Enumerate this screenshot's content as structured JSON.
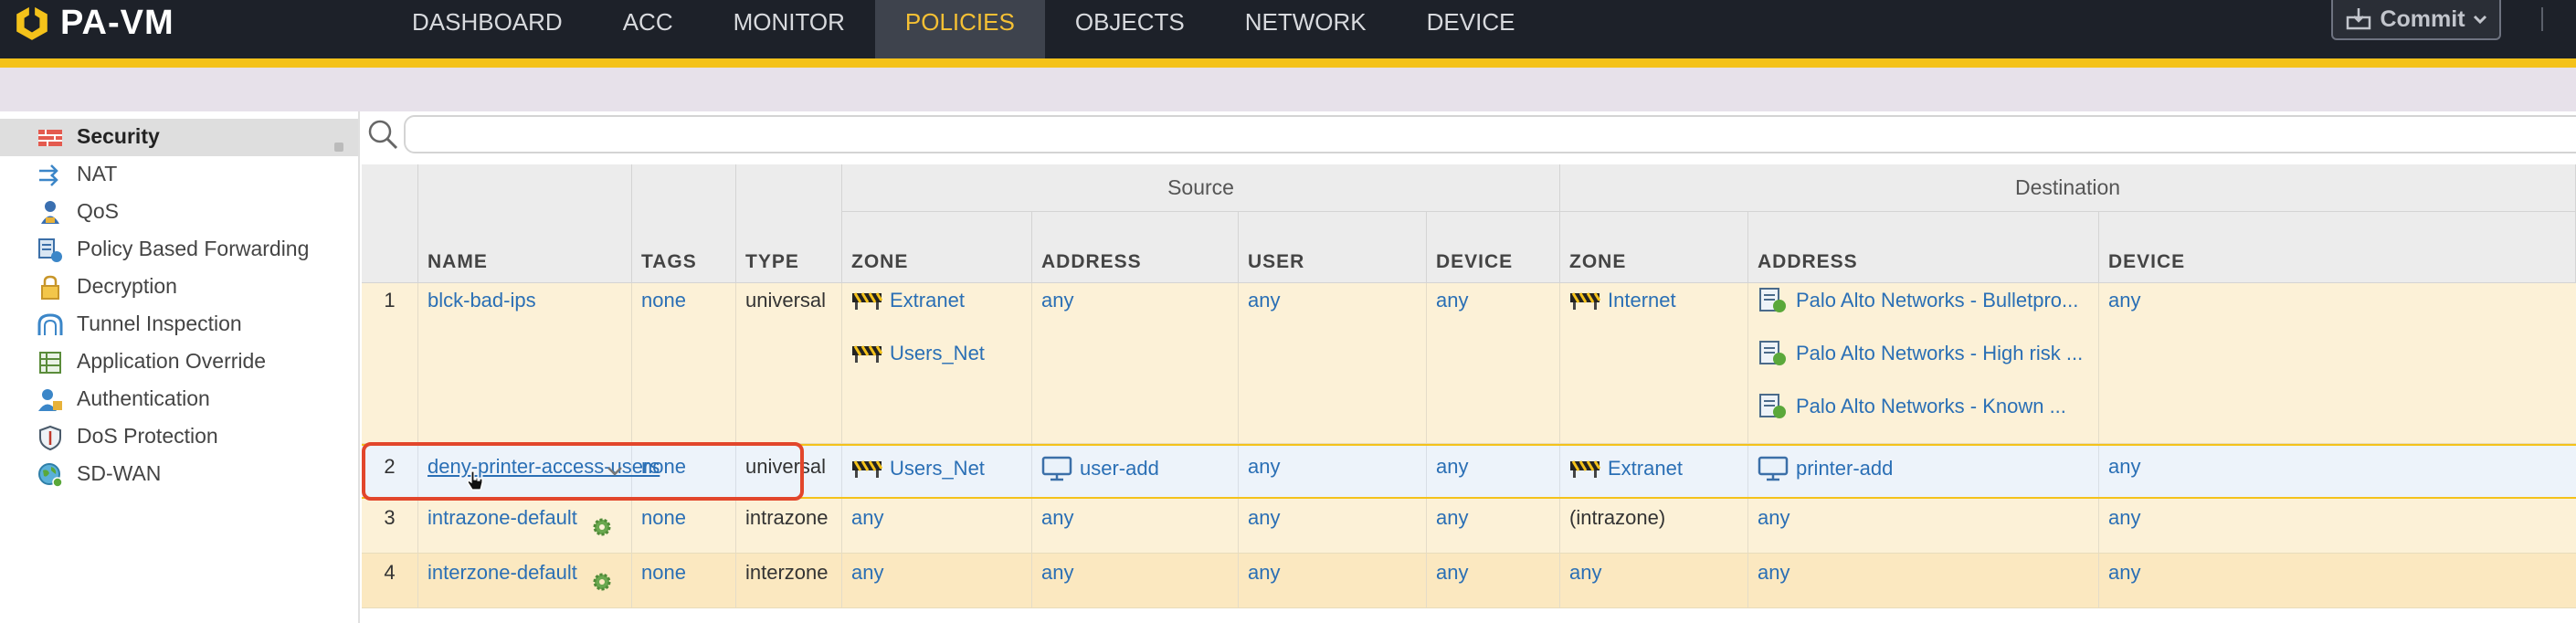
{
  "brand": {
    "name": "PA-VM"
  },
  "nav": {
    "tabs": [
      {
        "label": "DASHBOARD",
        "active": false
      },
      {
        "label": "ACC",
        "active": false
      },
      {
        "label": "MONITOR",
        "active": false
      },
      {
        "label": "POLICIES",
        "active": true
      },
      {
        "label": "OBJECTS",
        "active": false
      },
      {
        "label": "NETWORK",
        "active": false
      },
      {
        "label": "DEVICE",
        "active": false
      }
    ],
    "commit_label": "Commit"
  },
  "colors": {
    "accent": "#f4c21a",
    "topbar": "#1d2129",
    "selection_outline": "#e2462b",
    "link": "#2a6fb5"
  },
  "sidebar": {
    "items": [
      {
        "label": "Security",
        "icon": "firewall-icon",
        "active": true
      },
      {
        "label": "NAT",
        "icon": "nat-arrows-icon",
        "active": false
      },
      {
        "label": "QoS",
        "icon": "qos-person-icon",
        "active": false
      },
      {
        "label": "Policy Based Forwarding",
        "icon": "pbf-icon",
        "active": false
      },
      {
        "label": "Decryption",
        "icon": "lock-icon",
        "active": false
      },
      {
        "label": "Tunnel Inspection",
        "icon": "tunnel-icon",
        "active": false
      },
      {
        "label": "Application Override",
        "icon": "app-grid-icon",
        "active": false
      },
      {
        "label": "Authentication",
        "icon": "auth-icon",
        "active": false
      },
      {
        "label": "DoS Protection",
        "icon": "shield-icon",
        "active": false
      },
      {
        "label": "SD-WAN",
        "icon": "globe-icon",
        "active": false
      }
    ]
  },
  "search": {
    "value": "",
    "placeholder": ""
  },
  "table": {
    "groups": {
      "source": "Source",
      "destination": "Destination"
    },
    "columns": {
      "name": "NAME",
      "tags": "TAGS",
      "type": "TYPE",
      "src_zone": "ZONE",
      "src_address": "ADDRESS",
      "src_user": "USER",
      "src_device": "DEVICE",
      "dst_zone": "ZONE",
      "dst_address": "ADDRESS",
      "dst_device": "DEVICE"
    },
    "rows": [
      {
        "num": "1",
        "name": "blck-bad-ips",
        "tags": "none",
        "type": "universal",
        "src_zone": [
          "Extranet",
          "Users_Net"
        ],
        "src_address": [
          "any"
        ],
        "src_user": "any",
        "src_device": "any",
        "dst_zone": [
          "Internet"
        ],
        "dst_address": [
          "Palo Alto Networks - Bulletpro...",
          "Palo Alto Networks - High risk ...",
          "Palo Alto Networks - Known ..."
        ],
        "dst_device": "any"
      },
      {
        "num": "2",
        "name": "deny-printer-access-users",
        "tags": "none",
        "type": "universal",
        "src_zone": [
          "Users_Net"
        ],
        "src_address": [
          "user-add"
        ],
        "src_user": "any",
        "src_device": "any",
        "dst_zone": [
          "Extranet"
        ],
        "dst_address": [
          "printer-add"
        ],
        "dst_device": "any"
      },
      {
        "num": "3",
        "name": "intrazone-default",
        "tags": "none",
        "type": "intrazone",
        "src_zone": [
          "any"
        ],
        "src_address": [
          "any"
        ],
        "src_user": "any",
        "src_device": "any",
        "dst_zone": [
          "(intrazone)"
        ],
        "dst_address": [
          "any"
        ],
        "dst_device": "any"
      },
      {
        "num": "4",
        "name": "interzone-default",
        "tags": "none",
        "type": "interzone",
        "src_zone": [
          "any"
        ],
        "src_address": [
          "any"
        ],
        "src_user": "any",
        "src_device": "any",
        "dst_zone": [
          "any"
        ],
        "dst_address": [
          "any"
        ],
        "dst_device": "any"
      }
    ]
  }
}
